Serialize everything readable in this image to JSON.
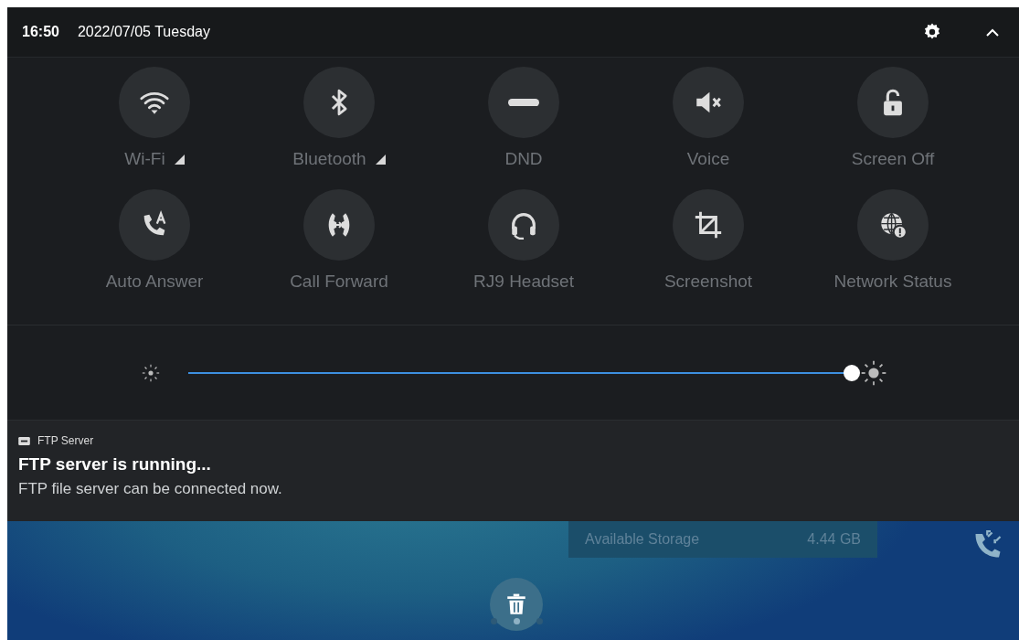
{
  "status_bar": {
    "time": "16:50",
    "date": "2022/07/05 Tuesday"
  },
  "tiles": [
    {
      "label": "Wi-Fi",
      "kind": "wifi",
      "has_menu": true
    },
    {
      "label": "Bluetooth",
      "kind": "bluetooth",
      "has_menu": true
    },
    {
      "label": "DND",
      "kind": "dnd",
      "has_menu": false
    },
    {
      "label": "Voice",
      "kind": "mute",
      "has_menu": false
    },
    {
      "label": "Screen Off",
      "kind": "lock",
      "has_menu": false
    },
    {
      "label": "Auto Answer",
      "kind": "autoanswer",
      "has_menu": false
    },
    {
      "label": "Call Forward",
      "kind": "forward",
      "has_menu": false
    },
    {
      "label": "RJ9 Headset",
      "kind": "headset",
      "has_menu": false
    },
    {
      "label": "Screenshot",
      "kind": "crop",
      "has_menu": false
    },
    {
      "label": "Network Status",
      "kind": "network",
      "has_menu": false
    }
  ],
  "brightness": {
    "level": 1
  },
  "notification": {
    "app": "FTP Server",
    "title": "FTP server is running...",
    "text": "FTP file server can be connected now."
  },
  "home": {
    "storage_label": "Available Storage",
    "storage_value": "4.44 GB",
    "pages": [
      {
        "selected": false
      },
      {
        "selected": true
      },
      {
        "selected": false
      }
    ]
  }
}
